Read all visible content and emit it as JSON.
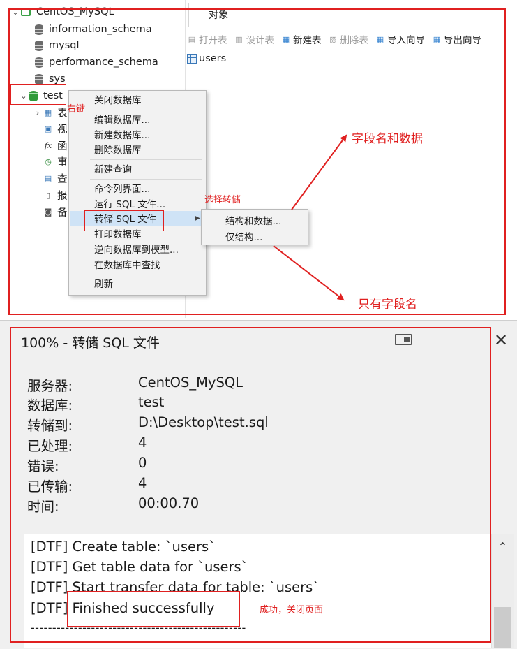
{
  "nav_tree": {
    "connection": "CentOS_MySQL",
    "databases": [
      "information_schema",
      "mysql",
      "performance_schema",
      "sys",
      "test"
    ],
    "test_children": [
      "表",
      "视",
      "函",
      "事",
      "查",
      "报",
      "备"
    ]
  },
  "objects_panel": {
    "tab": "对象",
    "toolbar": [
      {
        "label": "打开表",
        "enabled": false,
        "icon": "open-table-icon"
      },
      {
        "label": "设计表",
        "enabled": false,
        "icon": "design-table-icon"
      },
      {
        "label": "新建表",
        "enabled": true,
        "icon": "new-table-icon"
      },
      {
        "label": "删除表",
        "enabled": false,
        "icon": "delete-table-icon"
      },
      {
        "label": "导入向导",
        "enabled": true,
        "icon": "import-wizard-icon"
      },
      {
        "label": "导出向导",
        "enabled": true,
        "icon": "export-wizard-icon"
      }
    ],
    "tables": [
      "users"
    ]
  },
  "context_menu": {
    "items": [
      "关闭数据库",
      "编辑数据库...",
      "新建数据库...",
      "删除数据库",
      "新建查询",
      "命令列界面...",
      "运行 SQL 文件...",
      "转储 SQL 文件",
      "打印数据库",
      "逆向数据库到模型...",
      "在数据库中查找",
      "刷新"
    ],
    "highlighted": "转储 SQL 文件"
  },
  "submenu": {
    "items": [
      "结构和数据...",
      "仅结构..."
    ]
  },
  "annotations": {
    "right_click": "右键",
    "select_dump": "选择转储",
    "fields_and_data": "字段名和数据",
    "fields_only": "只有字段名",
    "success_close": "成功，关闭页面"
  },
  "dialog": {
    "title": "100% - 转储 SQL 文件",
    "info": [
      {
        "label": "服务器:",
        "value": "CentOS_MySQL"
      },
      {
        "label": "数据库:",
        "value": "test"
      },
      {
        "label": "转储到:",
        "value": "D:\\Desktop\\test.sql"
      },
      {
        "label": "已处理:",
        "value": "4"
      },
      {
        "label": "错误:",
        "value": "0"
      },
      {
        "label": "已传输:",
        "value": "4"
      },
      {
        "label": "时间:",
        "value": "00:00.70"
      }
    ],
    "log": [
      "[DTF] Create table: `users`",
      "[DTF] Get table data for `users`",
      "[DTF] Start transfer data for table: `users`",
      "[DTF] Finished successfully",
      "--------------------------------------------------"
    ]
  },
  "colors": {
    "annotation_red": "#e02020",
    "menu_highlight": "#cfe3f6",
    "db_green": "#2f9a3a"
  }
}
